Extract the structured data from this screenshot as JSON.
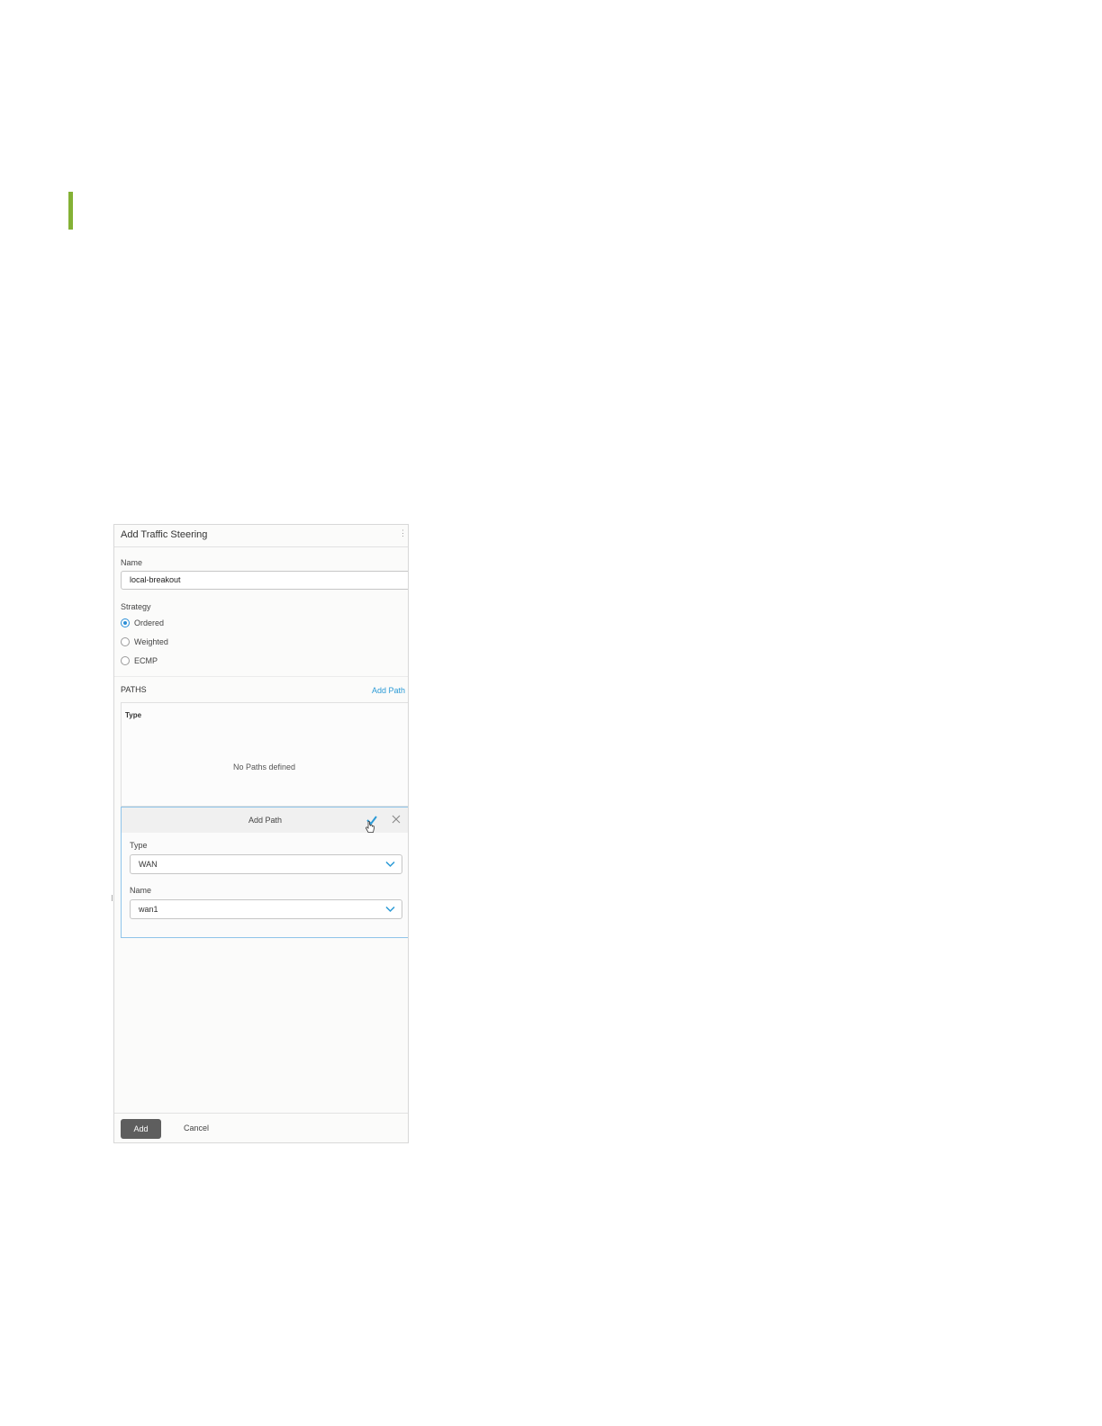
{
  "colors": {
    "accent_bar": "#84b135",
    "link": "#2b9ad6",
    "selected_radio": "#2b8ed6",
    "primary_button": "#5e5e5e"
  },
  "dialog": {
    "title": "Add Traffic Steering",
    "name_label": "Name",
    "name_value": "local-breakout",
    "strategy_label": "Strategy",
    "strategy_options": [
      {
        "label": "Ordered",
        "selected": true
      },
      {
        "label": "Weighted",
        "selected": false
      },
      {
        "label": "ECMP",
        "selected": false
      }
    ],
    "paths_label": "PATHS",
    "add_path_link": "Add Path",
    "paths_table": {
      "column_type": "Type",
      "empty_message": "No Paths defined"
    },
    "add_path_form": {
      "title": "Add Path",
      "confirm_icon": "checkmark-icon",
      "cancel_icon": "close-icon",
      "type_label": "Type",
      "type_value": "WAN",
      "name_label": "Name",
      "name_value": "wan1"
    },
    "footer": {
      "add_button": "Add",
      "cancel_button": "Cancel"
    }
  }
}
